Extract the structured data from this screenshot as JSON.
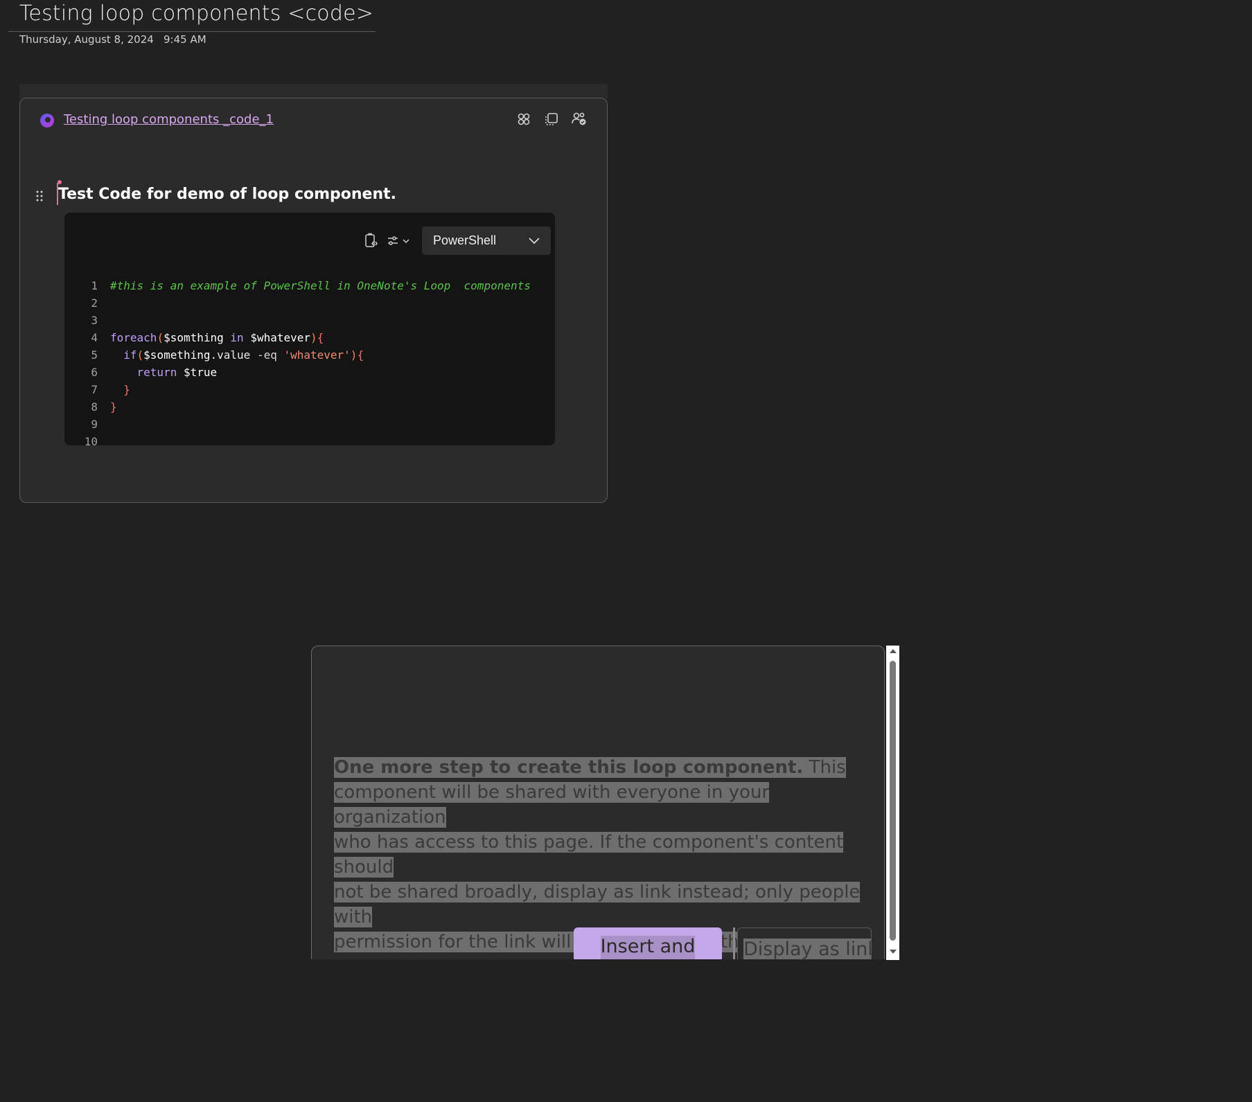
{
  "page": {
    "title": "Testing loop components <code>",
    "date": "Thursday, August 8, 2024",
    "time": "9:45 AM"
  },
  "loop_component": {
    "link_text": "Testing loop components _code_1",
    "actions": [
      {
        "icon": "loop-apps-icon"
      },
      {
        "icon": "copy-component-icon"
      },
      {
        "icon": "shared-people-icon"
      }
    ],
    "heading": "Test Code for demo of loop component.",
    "code_block": {
      "language": "PowerShell",
      "tools": [
        "copy-code-icon",
        "format-options-icon"
      ],
      "line_numbers": [
        "1",
        "2",
        "3",
        "4",
        "5",
        "6",
        "7",
        "8",
        "9",
        "10"
      ],
      "lines": [
        {
          "tokens": [
            {
              "t": "#this is an example of PowerShell in OneNote's Loop  components",
              "c": "c-comment"
            }
          ]
        },
        {
          "tokens": []
        },
        {
          "tokens": []
        },
        {
          "tokens": [
            {
              "t": "foreach",
              "c": "c-kw"
            },
            {
              "t": "(",
              "c": "c-paren"
            },
            {
              "t": "$somthing",
              "c": "c-var"
            },
            {
              "t": " in ",
              "c": "c-kw"
            },
            {
              "t": "$whatever",
              "c": "c-var"
            },
            {
              "t": ")",
              "c": "c-paren"
            },
            {
              "t": "{",
              "c": "c-brace"
            }
          ]
        },
        {
          "tokens": [
            {
              "t": "  if",
              "c": "c-kw"
            },
            {
              "t": "(",
              "c": "c-paren"
            },
            {
              "t": "$something",
              "c": "c-var"
            },
            {
              "t": ".value ",
              "c": "c-prop"
            },
            {
              "t": "-eq ",
              "c": "c-op"
            },
            {
              "t": "'whatever'",
              "c": "c-str"
            },
            {
              "t": ")",
              "c": "c-paren"
            },
            {
              "t": "{",
              "c": "c-brace"
            }
          ]
        },
        {
          "tokens": [
            {
              "t": "    return ",
              "c": "c-kw"
            },
            {
              "t": "$true",
              "c": "c-var"
            }
          ]
        },
        {
          "tokens": [
            {
              "t": "  }",
              "c": "c-brace"
            }
          ]
        },
        {
          "tokens": [
            {
              "t": "}",
              "c": "c-brace"
            }
          ]
        },
        {
          "tokens": []
        },
        {
          "tokens": []
        }
      ]
    }
  },
  "dialog": {
    "bold_text": "One more step to create this loop component.",
    "lines": [
      " This",
      "component will be shared with everyone in your organization",
      "who has access to this page. If the component's content should",
      "not be shared broadly, display as link instead; only people with",
      "permission for the link will be able to view the component."
    ],
    "primary_button": "Insert and share",
    "secondary_button": "Display as link"
  }
}
